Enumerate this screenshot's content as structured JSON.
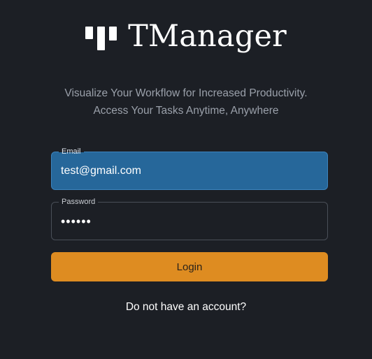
{
  "brand": {
    "name": "TManager",
    "logo_icon": "bars-logo-icon"
  },
  "tagline": {
    "line1": "Visualize Your Workflow for Increased Productivity.",
    "line2": "Access Your Tasks Anytime, Anywhere"
  },
  "form": {
    "email": {
      "label": "Email",
      "value": "test@gmail.com"
    },
    "password": {
      "label": "Password",
      "value": "••••••"
    },
    "login_label": "Login",
    "signup_link": "Do not have an account?"
  },
  "colors": {
    "background": "#1c1f25",
    "accent": "#de8c21",
    "email_field_active": "#26679a"
  }
}
